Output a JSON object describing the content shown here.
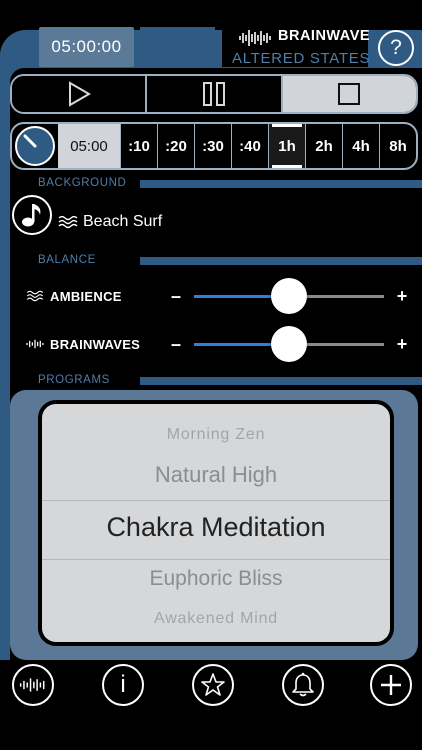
{
  "header": {
    "timer": "05:00:00",
    "brand_title": "BRAINWAVE",
    "brand_subtitle": "ALTERED STATES",
    "help_label": "?"
  },
  "transport": {
    "active": "stop"
  },
  "duration": {
    "current": "05:00",
    "options": [
      ":10",
      ":20",
      ":30",
      ":40",
      "1h",
      "2h",
      "4h",
      "8h"
    ],
    "selected": "1h"
  },
  "background": {
    "section_label": "BACKGROUND",
    "sound_name": "Beach Surf"
  },
  "balance": {
    "section_label": "BALANCE",
    "ambience_label": "AMBIENCE",
    "brainwaves_label": "BRAINWAVES",
    "minus": "–",
    "plus": "+",
    "ambience_level": 0.5,
    "brainwaves_level": 0.5
  },
  "programs": {
    "section_label": "PROGRAMS",
    "items": [
      "Morning Zen",
      "Natural High",
      "Chakra Meditation",
      "Euphoric Bliss",
      "Awakened Mind"
    ],
    "selected": "Chakra Meditation"
  },
  "toolbar": {
    "info_label": "i"
  },
  "colors": {
    "chrome_blue": "#2e5a83",
    "label_blue": "#4f7ea8",
    "slider_fill": "#2f7ee6"
  }
}
